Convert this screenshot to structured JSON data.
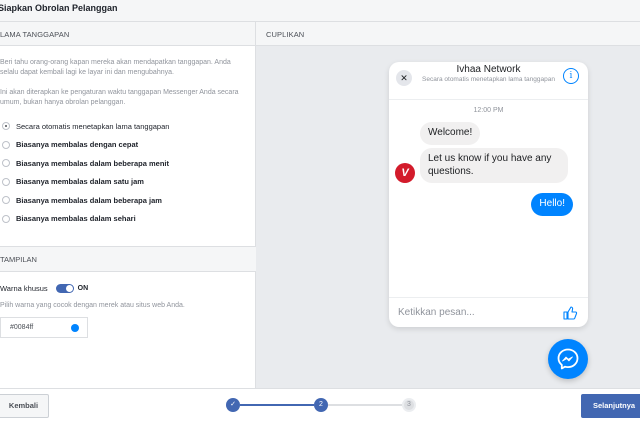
{
  "header": {
    "title": "Siapkan Obrolan Pelanggan"
  },
  "left": {
    "response_section": "LAMA TANGGAPAN",
    "paragraph1": "Beri tahu orang-orang kapan mereka akan mendapatkan tanggapan. Anda selalu dapat kembali lagi ke layar ini dan mengubahnya.",
    "paragraph2": "Ini akan diterapkan ke pengaturan waktu tanggapan Messenger Anda secara umum, bukan hanya obrolan pelanggan.",
    "options": [
      {
        "label": "Secara otomatis menetapkan lama tanggapan",
        "selected": true
      },
      {
        "label": "Biasanya membalas dengan cepat",
        "selected": false
      },
      {
        "label": "Biasanya membalas dalam beberapa menit",
        "selected": false
      },
      {
        "label": "Biasanya membalas dalam satu jam",
        "selected": false
      },
      {
        "label": "Biasanya membalas dalam beberapa jam",
        "selected": false
      },
      {
        "label": "Biasanya membalas dalam sehari",
        "selected": false
      }
    ],
    "display_section": "TAMPILAN",
    "custom_color_label": "Warna khusus",
    "toggle_state": "ON",
    "color_hint": "Pilih warna yang cocok dengan merek atau situs web Anda.",
    "color_value": "#0084ff"
  },
  "preview": {
    "section": "CUPLIKAN",
    "chat_name": "Ivhaa Network",
    "chat_sub": "Secara otomatis menetapkan lama tanggapan",
    "time": "12:00 PM",
    "msg1": "Welcome!",
    "msg2": "Let us know if you have any questions.",
    "msg3": "Hello!",
    "composer_placeholder": "Ketikkan pesan...",
    "close_glyph": "✕",
    "info_glyph": "i",
    "avatar_glyph": "V"
  },
  "footer": {
    "back": "Kembali",
    "next": "Selanjutnya",
    "steps": [
      "✓",
      "2",
      "3"
    ]
  },
  "colors": {
    "accent": "#4267b2",
    "messenger_blue": "#0084ff"
  }
}
